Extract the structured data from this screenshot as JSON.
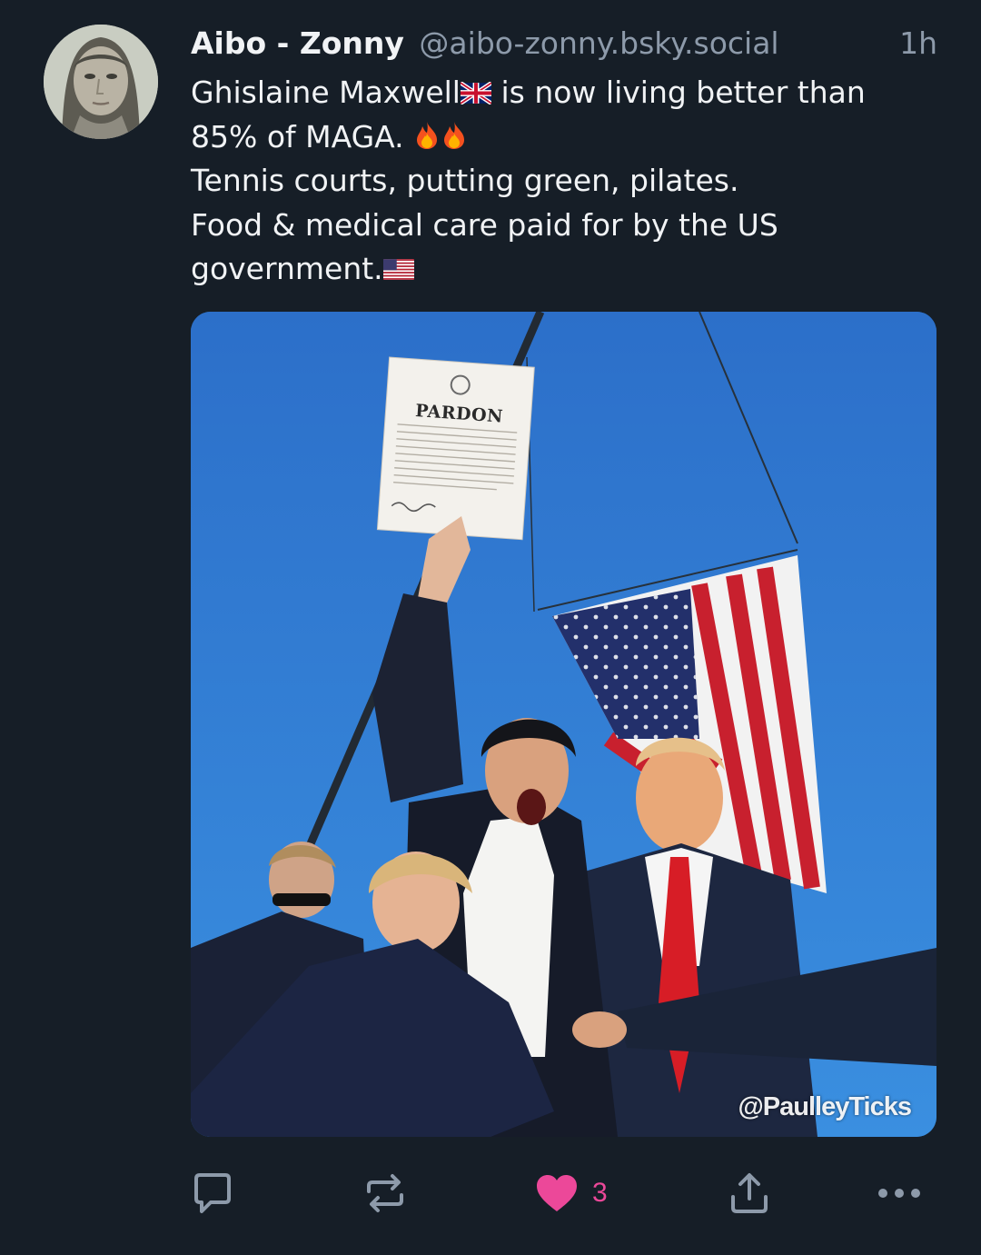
{
  "post": {
    "author": {
      "display_name": "Aibo - Zonny",
      "handle": "@aibo-zonny.bsky.social"
    },
    "timestamp": "1h",
    "text_lines": [
      "Ghislaine Maxwell",
      "is now living better than",
      "85% of MAGA.",
      "Tennis courts, putting green, pilates.",
      "Food & medical care paid for by the US",
      "government."
    ],
    "emoji": [
      "uk-flag",
      "fire",
      "fire",
      "us-flag"
    ],
    "image": {
      "document_title": "PARDON",
      "watermark": "@PaulleyTicks"
    },
    "actions": {
      "reply_icon": "speech-bubble-icon",
      "repost_icon": "repost-arrows-icon",
      "like_icon": "heart-icon",
      "like_count": "3",
      "share_icon": "share-icon",
      "more_icon": "ellipsis-icon"
    },
    "colors": {
      "background": "#161e27",
      "text": "#f1f3f5",
      "muted": "#8d9aaa",
      "like": "#ec4899",
      "sky": "#2f7fd5"
    }
  }
}
